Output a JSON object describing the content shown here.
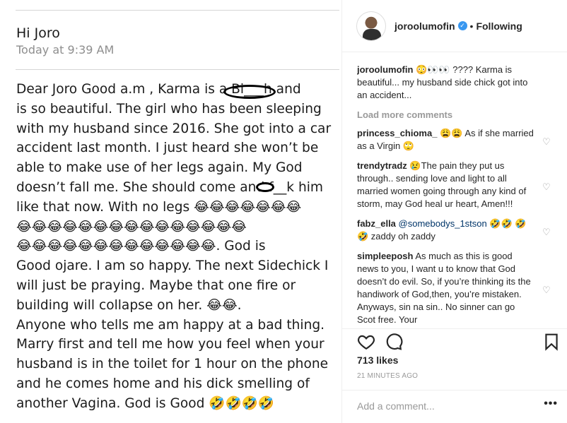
{
  "image": {
    "from": "Hi Joro",
    "time": "Today at 9:39 AM",
    "body_lines": [
      "Dear Joro Good a.m , Karma is a Bi___h and",
      "is so beautiful. The girl who has been sleeping",
      "with my husband since 2016. She got into a car",
      "accident last month. I just heard she won’t be",
      "able to make use of her legs again. My God",
      "doesn’t fall me. She should come and f__k him",
      "like that now. With no legs 😂😂😂😂😂😂😂",
      "😂😂😂😂😂😂😂😂😂😂😂😂😂😂😂",
      "😂😂😂😂😂😂😂😂😂😂😂😂😂. God is",
      "Good ojare. I am so happy. The next Sidechick I",
      "will just be praying. Maybe that one fire or",
      "building will collapse on her. 😂😂.",
      "Anyone who tells me am happy at a bad thing.",
      "Marry first and tell me how you feel when your",
      "husband is in the toilet for 1 hour on the phone",
      "and he comes home and his dick smelling of",
      "another Vagina. God is Good 🤣🤣🤣🤣"
    ]
  },
  "header": {
    "username": "joroolumofin",
    "verified_icon": "verified-badge-icon",
    "dot": "•",
    "follow_status": "Following"
  },
  "caption": {
    "user": "joroolumofin",
    "text": "😳👀👀 ???? Karma is beautiful... my husband side chick got into an accident..."
  },
  "load_more": "Load more comments",
  "comments": [
    {
      "user": "princess_chioma_",
      "text": "😩😩 As if she married as a Virgin 🙄"
    },
    {
      "user": "trendytradz",
      "text": "😢The pain they put us through.. sending love and light to all married women going through any kind of storm, may God heal ur heart, Amen!!!"
    },
    {
      "user": "fabz_ella",
      "mention": "@somebodys_1stson",
      "text": "🤣🤣 🤣🤣 zaddy oh zaddy"
    },
    {
      "user": "simpleeposh",
      "text": "As much as this is good news to you, I want u to know that God doesn’t do evil. So, if you’re thinking its the handiwork of God,then, you’re mistaken. Anyways, sin na sin.. No sinner can go Scot free. Your"
    }
  ],
  "likes": "713 likes",
  "time_ago": "21 MINUTES AGO",
  "add_comment_placeholder": "Add a comment...",
  "more_label": "•••",
  "heart_glyph": "♡",
  "colors": {
    "link": "#003569",
    "verified": "#3897f0",
    "muted": "#999999"
  }
}
